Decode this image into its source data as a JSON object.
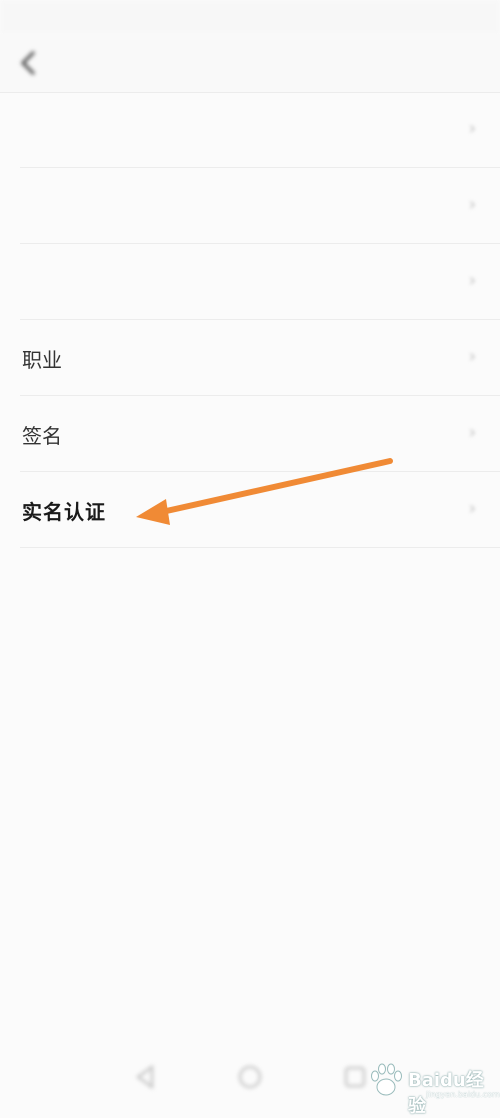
{
  "status_bar": {
    "left_text": "",
    "right_text": ""
  },
  "header": {
    "title": "",
    "back_icon": "chevron-left-icon"
  },
  "rows": [
    {
      "label": "",
      "value": "",
      "emphasis": "blurred"
    },
    {
      "label": "",
      "value": "",
      "emphasis": "blurred"
    },
    {
      "label": "",
      "value": "",
      "emphasis": "blurred"
    },
    {
      "label": "职业",
      "value": "",
      "emphasis": "normal"
    },
    {
      "label": "签名",
      "value": "",
      "emphasis": "normal"
    },
    {
      "label": "实名认证",
      "value": "",
      "emphasis": "bold",
      "value_color": "#2cbd84"
    }
  ],
  "annotation": {
    "type": "arrow",
    "color": "#f08a35",
    "points_to": "实名认证"
  },
  "nav_bar": {
    "items": [
      "back-triangle-icon",
      "home-circle-icon",
      "recents-square-icon"
    ]
  },
  "watermark": {
    "brand": "Baidu经验",
    "url": "jingyan.baidu.com"
  },
  "colors": {
    "accent_green": "#2cbd84",
    "arrow_orange": "#f08a35",
    "divider": "#ececec"
  }
}
